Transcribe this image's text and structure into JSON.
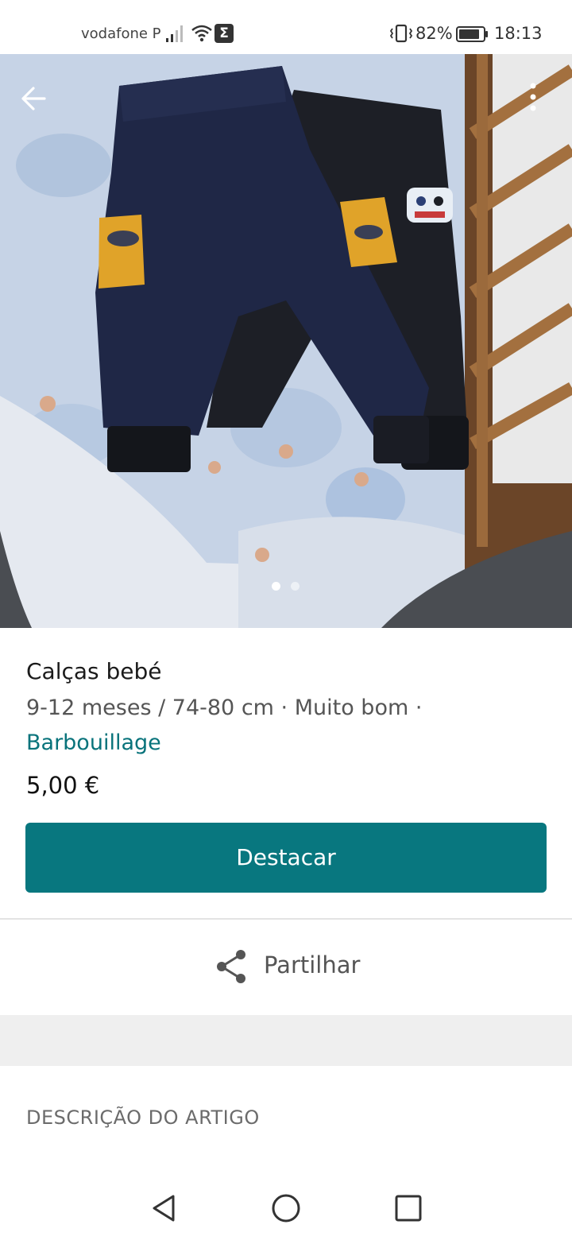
{
  "status_bar": {
    "carrier": "vodafone P",
    "sigma_glyph": "Σ",
    "battery_percent": "82%",
    "time": "18:13",
    "icons": [
      "signal-bars-icon",
      "wifi-icon",
      "sigma-app-icon",
      "vibrate-icon",
      "battery-icon"
    ]
  },
  "photo": {
    "alt": "",
    "page_count": 2,
    "current_page": 1,
    "controls": [
      "back-arrow-icon",
      "more-vertical-icon"
    ]
  },
  "item": {
    "title": "Calças bebé",
    "details": "9-12 meses / 74-80 cm · Muito bom ·",
    "brand": "Barbouillage",
    "price": "5,00 €"
  },
  "actions": {
    "primary_label": "Destacar",
    "share_label": "Partilhar"
  },
  "description": {
    "section_title": "DESCRIÇÃO DO ARTIGO"
  },
  "nav_bar": {
    "icons": [
      "triangle-back-icon",
      "circle-home-icon",
      "square-recents-icon"
    ]
  },
  "colors": {
    "accent": "#08777f",
    "brand_link": "#08737b",
    "band": "#efefef"
  }
}
